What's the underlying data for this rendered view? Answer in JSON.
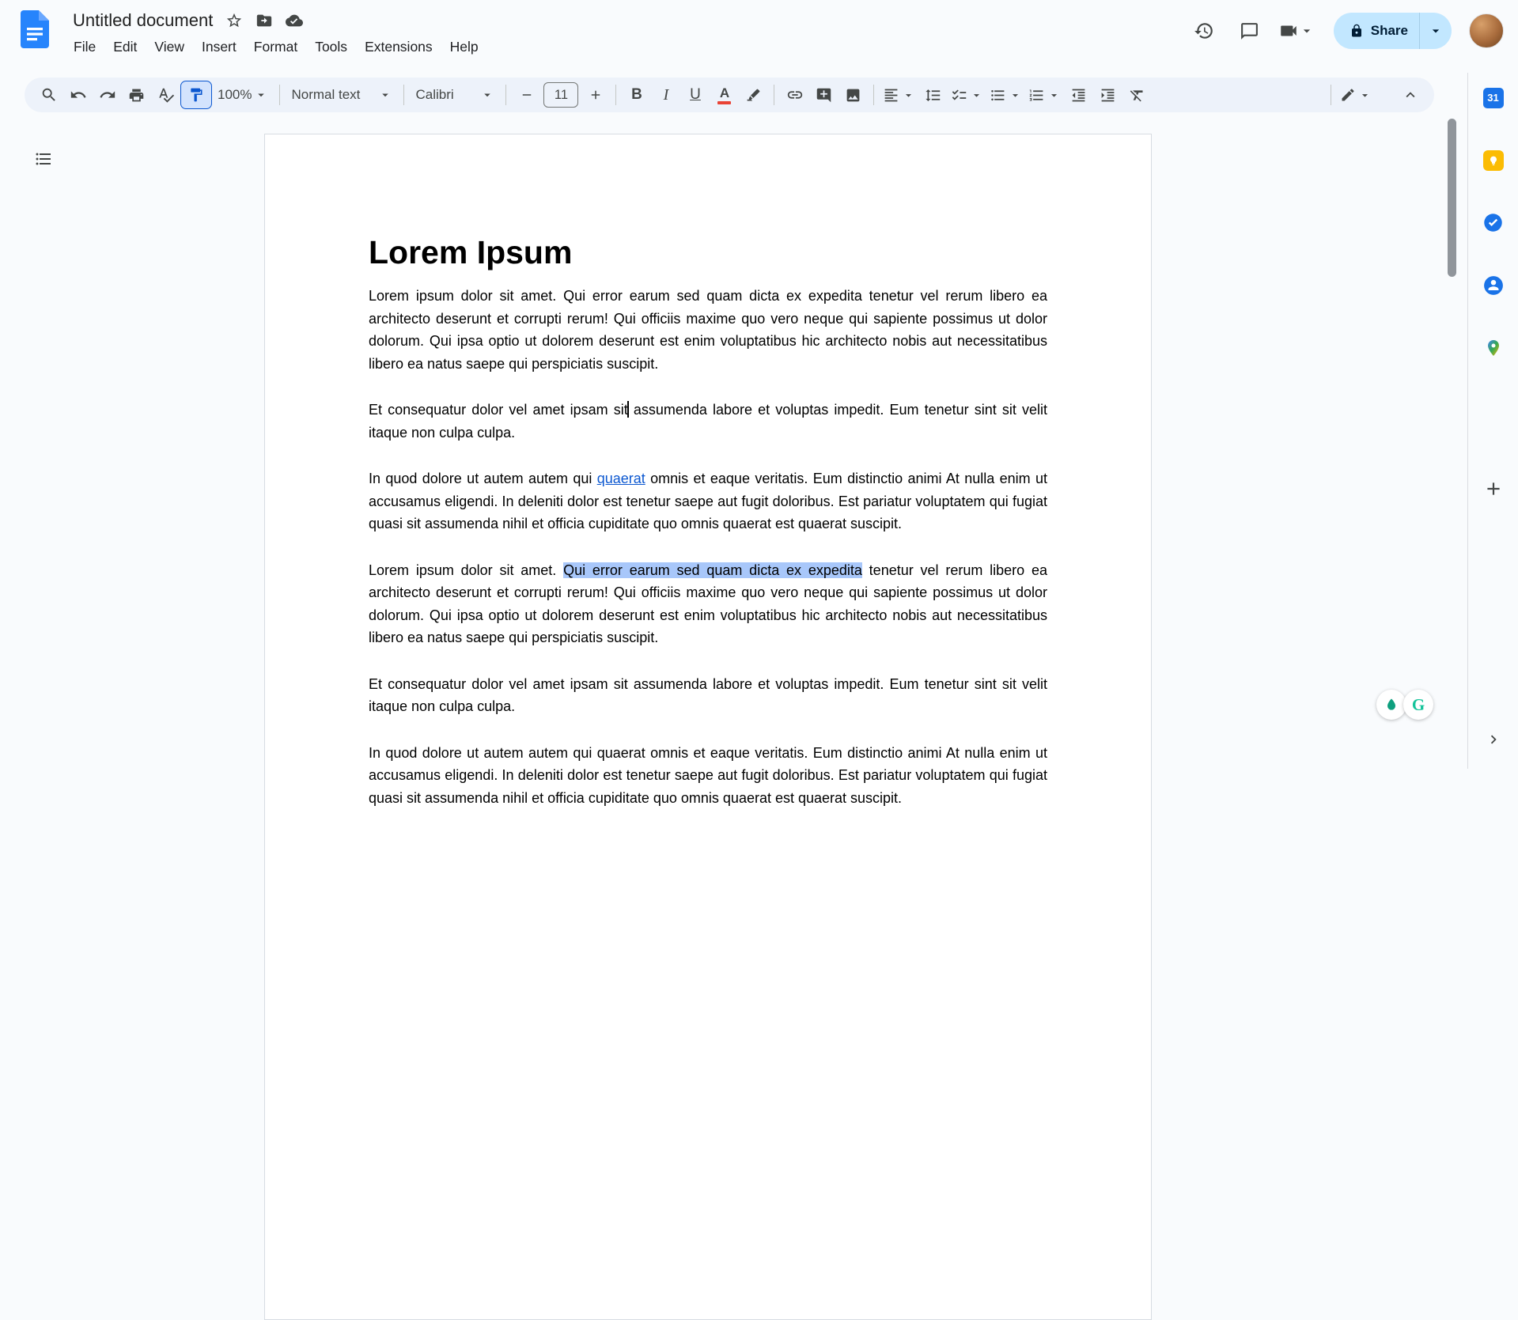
{
  "header": {
    "doc_title": "Untitled document",
    "menus": [
      "File",
      "Edit",
      "View",
      "Insert",
      "Format",
      "Tools",
      "Extensions",
      "Help"
    ],
    "share_label": "Share"
  },
  "toolbar": {
    "zoom": "100%",
    "paragraph_style": "Normal text",
    "font": "Calibri",
    "font_size": "11",
    "bold_label": "B",
    "italic_label": "I",
    "underline_label": "U",
    "text_color_label": "A"
  },
  "document": {
    "title": "Lorem Ipsum",
    "paragraph1": "Lorem ipsum dolor sit amet. Qui error earum sed quam dicta ex expedita tenetur vel rerum libero ea architecto deserunt et corrupti rerum! Qui officiis maxime quo vero neque qui sapiente possimus ut dolor dolorum. Qui ipsa optio ut dolorem deserunt est enim voluptatibus hic architecto nobis aut necessitatibus libero ea natus saepe qui perspiciatis suscipit.",
    "paragraph2_before_cursor": "Et consequatur dolor vel amet ipsam sit",
    "paragraph2_after_cursor": " assumenda labore et voluptas impedit. Eum tenetur sint sit velit itaque non culpa culpa.",
    "paragraph3_before_link": "In quod dolore ut autem autem qui ",
    "paragraph3_link": "quaerat",
    "paragraph3_after_link": " omnis et eaque veritatis. Eum distinctio animi At nulla enim ut accusamus eligendi. In deleniti dolor est tenetur saepe aut fugit doloribus. Est pariatur voluptatem qui fugiat quasi sit assumenda nihil et officia cupiditate quo omnis quaerat est quaerat suscipit.",
    "paragraph4_before_selection": "Lorem ipsum dolor sit amet. ",
    "paragraph4_selected": "Qui error earum sed quam dicta ex expedita",
    "paragraph4_after_selection": " tenetur vel rerum libero ea architecto deserunt et corrupti rerum! Qui officiis maxime quo vero neque qui sapiente possimus ut dolor dolorum. Qui ipsa optio ut dolorem deserunt est enim voluptatibus hic architecto nobis aut necessitatibus libero ea natus saepe qui perspiciatis suscipit.",
    "paragraph5": "Et consequatur dolor vel amet ipsam sit assumenda labore et voluptas impedit. Eum tenetur sint sit velit itaque non culpa culpa.",
    "paragraph6": "In quod dolore ut autem autem qui quaerat omnis et eaque veritatis. Eum distinctio animi At nulla enim ut accusamus eligendi. In deleniti dolor est tenetur saepe aut fugit doloribus. Est pariatur voluptatem qui fugiat quasi sit assumenda nihil et officia cupiditate quo omnis quaerat est quaerat suscipit."
  },
  "side_panel": {
    "calendar_label": "31"
  },
  "colors": {
    "link": "#0b57d0",
    "selection": "#a8c7fa",
    "toolbar_bg": "#edf2fa",
    "active_button_bg": "#d3e3fd",
    "share_button_bg": "#c2e7ff"
  }
}
